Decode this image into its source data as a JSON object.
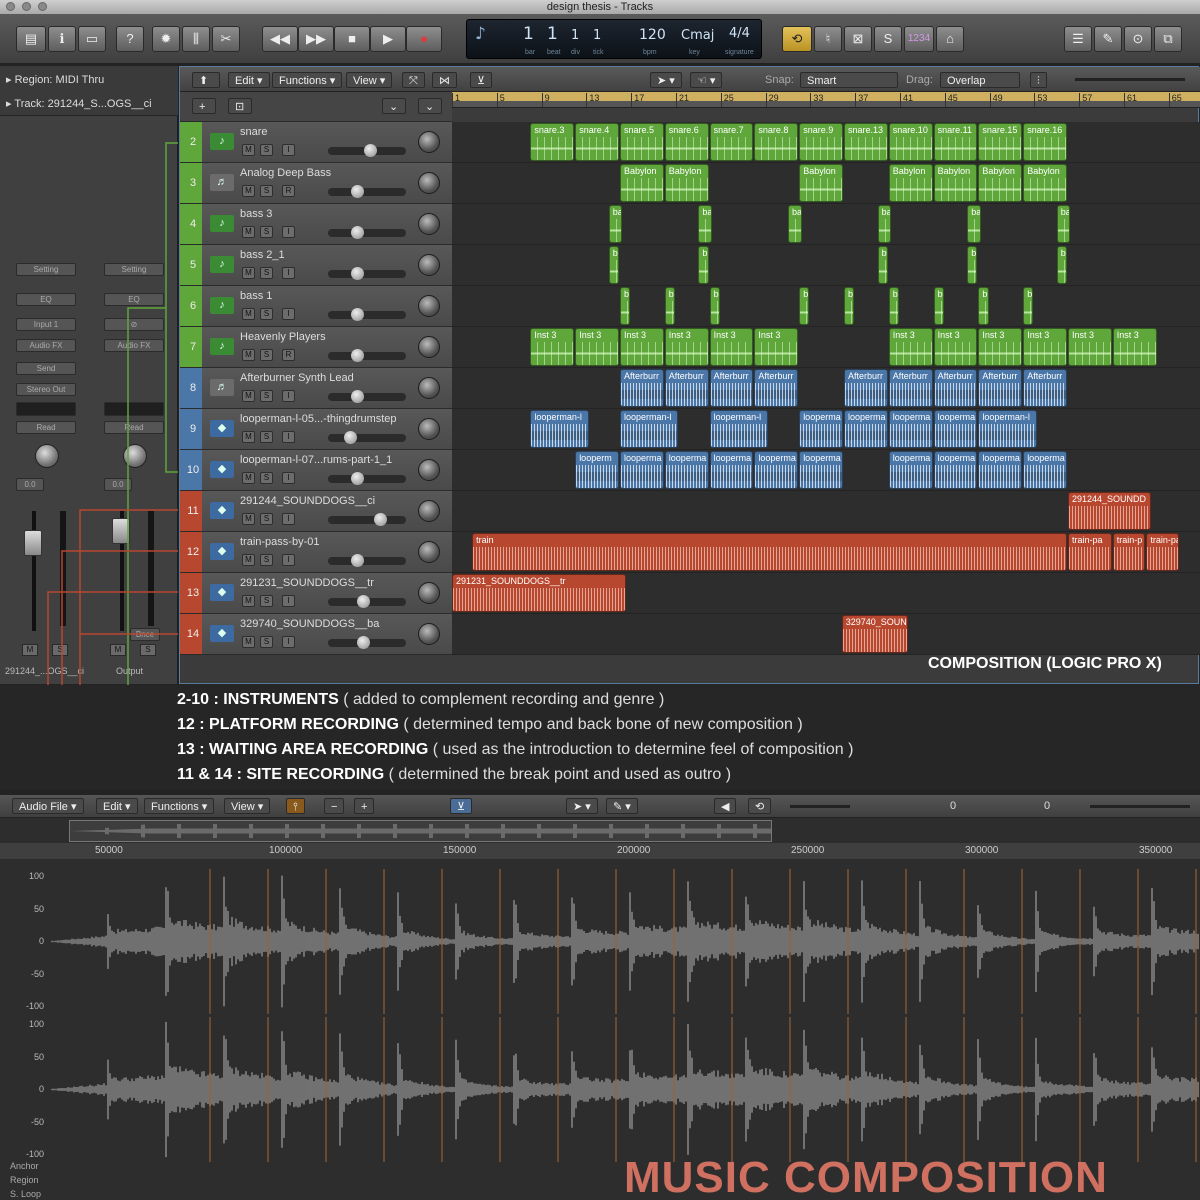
{
  "window": {
    "title": "design thesis - Tracks"
  },
  "lcd": {
    "bar": "1",
    "beat": "1",
    "div": "1",
    "tick": "1",
    "bpm": "120",
    "key": "Cmaj",
    "signature": "4/4",
    "labels": {
      "bar": "bar",
      "beat": "beat",
      "div": "div",
      "tick": "tick",
      "bpm": "bpm",
      "key": "key",
      "signature": "signature"
    }
  },
  "toolbar": {
    "count_in": "1234"
  },
  "inspector": {
    "region": "Region: MIDI Thru",
    "track": "Track: 291244_S...OGS__ci",
    "left_strip": {
      "setting": "Setting",
      "eq": "EQ",
      "input": "Input 1",
      "audio_fx": "Audio FX",
      "send": "Send",
      "output": "Stereo Out",
      "mode": "Read",
      "value": "0.0",
      "name": "291244_...OGS__ci"
    },
    "right_strip": {
      "setting": "Setting",
      "eq": "EQ",
      "audio_fx": "Audio FX",
      "mode": "Read",
      "value": "0.0",
      "bounce": "Bnce",
      "name": "Output"
    }
  },
  "local_bar": {
    "edit": "Edit",
    "functions": "Functions",
    "view": "View",
    "snap_label": "Snap:",
    "snap_value": "Smart",
    "drag_label": "Drag:",
    "drag_value": "Overlap"
  },
  "ruler": [
    "1",
    "5",
    "9",
    "13",
    "17",
    "21",
    "25",
    "29",
    "33",
    "37",
    "41",
    "45",
    "49",
    "53",
    "57",
    "61",
    "65"
  ],
  "tracks": [
    {
      "num": "2",
      "name": "snare",
      "color": "green",
      "type": "midi",
      "third": "I",
      "vol": 0.55,
      "regions": [
        {
          "l": "snare.3",
          "s": 8,
          "e": 12
        },
        {
          "l": "snare.4",
          "s": 12,
          "e": 16
        },
        {
          "l": "snare.5",
          "s": 16,
          "e": 20
        },
        {
          "l": "snare.6",
          "s": 20,
          "e": 24
        },
        {
          "l": "snare.7",
          "s": 24,
          "e": 28
        },
        {
          "l": "snare.8",
          "s": 28,
          "e": 32
        },
        {
          "l": "snare.9",
          "s": 32,
          "e": 36
        },
        {
          "l": "snare.13",
          "s": 36,
          "e": 40
        },
        {
          "l": "snare.10",
          "s": 40,
          "e": 44
        },
        {
          "l": "snare.11",
          "s": 44,
          "e": 48
        },
        {
          "l": "snare.15",
          "s": 48,
          "e": 52
        },
        {
          "l": "snare.16",
          "s": 52,
          "e": 56
        }
      ]
    },
    {
      "num": "3",
      "name": "Analog Deep Bass",
      "color": "green",
      "type": "synth",
      "third": "R",
      "vol": 0.35,
      "regions": [
        {
          "l": "Babylon",
          "s": 16,
          "e": 20
        },
        {
          "l": "Babylon",
          "s": 20,
          "e": 24
        },
        {
          "l": "Babylon",
          "s": 32,
          "e": 36
        },
        {
          "l": "Babylon",
          "s": 40,
          "e": 44
        },
        {
          "l": "Babylon",
          "s": 44,
          "e": 48
        },
        {
          "l": "Babylon",
          "s": 48,
          "e": 52
        },
        {
          "l": "Babylon",
          "s": 52,
          "e": 56
        }
      ]
    },
    {
      "num": "4",
      "name": "bass 3",
      "color": "green",
      "type": "midi",
      "third": "I",
      "vol": 0.35,
      "regions": [
        {
          "l": "ba",
          "s": 15,
          "e": 16.3
        },
        {
          "l": "ba",
          "s": 23,
          "e": 24.3
        },
        {
          "l": "ba",
          "s": 31,
          "e": 32.3
        },
        {
          "l": "ba",
          "s": 39,
          "e": 40.3
        },
        {
          "l": "ba",
          "s": 47,
          "e": 48.3
        },
        {
          "l": "ba",
          "s": 55,
          "e": 56.3
        }
      ]
    },
    {
      "num": "5",
      "name": "bass 2_1",
      "color": "green",
      "type": "midi",
      "third": "I",
      "vol": 0.35,
      "regions": [
        {
          "l": "b",
          "s": 15,
          "e": 16
        },
        {
          "l": "b",
          "s": 23,
          "e": 24
        },
        {
          "l": "b",
          "s": 39,
          "e": 40
        },
        {
          "l": "b",
          "s": 47,
          "e": 48
        },
        {
          "l": "b",
          "s": 55,
          "e": 56
        }
      ]
    },
    {
      "num": "6",
      "name": "bass 1",
      "color": "green",
      "type": "midi",
      "third": "I",
      "vol": 0.35,
      "regions": [
        {
          "l": "b",
          "s": 16,
          "e": 17
        },
        {
          "l": "b",
          "s": 20,
          "e": 21
        },
        {
          "l": "b",
          "s": 24,
          "e": 25
        },
        {
          "l": "b",
          "s": 32,
          "e": 33
        },
        {
          "l": "b",
          "s": 36,
          "e": 37
        },
        {
          "l": "b",
          "s": 40,
          "e": 41
        },
        {
          "l": "b",
          "s": 44,
          "e": 45
        },
        {
          "l": "b",
          "s": 48,
          "e": 49
        },
        {
          "l": "b",
          "s": 52,
          "e": 53
        }
      ]
    },
    {
      "num": "7",
      "name": "Heavenly Players",
      "color": "green",
      "type": "midi",
      "third": "R",
      "vol": 0.35,
      "regions": [
        {
          "l": "Inst 3",
          "s": 8,
          "e": 12
        },
        {
          "l": "Inst 3",
          "s": 12,
          "e": 16
        },
        {
          "l": "Inst 3",
          "s": 16,
          "e": 20
        },
        {
          "l": "Inst 3",
          "s": 20,
          "e": 24
        },
        {
          "l": "Inst 3",
          "s": 24,
          "e": 28
        },
        {
          "l": "Inst 3",
          "s": 28,
          "e": 32
        },
        {
          "l": "Inst 3",
          "s": 40,
          "e": 44
        },
        {
          "l": "Inst 3",
          "s": 44,
          "e": 48
        },
        {
          "l": "Inst 3",
          "s": 48,
          "e": 52
        },
        {
          "l": "Inst 3",
          "s": 52,
          "e": 56
        },
        {
          "l": "Inst 3",
          "s": 56,
          "e": 60
        },
        {
          "l": "Inst 3",
          "s": 60,
          "e": 64
        }
      ]
    },
    {
      "num": "8",
      "name": "Afterburner Synth Lead",
      "color": "blue",
      "type": "synth",
      "third": "I",
      "vol": 0.35,
      "regions": [
        {
          "l": "Afterburr",
          "s": 16,
          "e": 20
        },
        {
          "l": "Afterburr",
          "s": 20,
          "e": 24
        },
        {
          "l": "Afterburr",
          "s": 24,
          "e": 28
        },
        {
          "l": "Afterburr",
          "s": 28,
          "e": 32
        },
        {
          "l": "Afterburr",
          "s": 36,
          "e": 40
        },
        {
          "l": "Afterburr",
          "s": 40,
          "e": 44
        },
        {
          "l": "Afterburr",
          "s": 44,
          "e": 48
        },
        {
          "l": "Afterburr",
          "s": 48,
          "e": 52
        },
        {
          "l": "Afterburr",
          "s": 52,
          "e": 56
        }
      ]
    },
    {
      "num": "9",
      "name": "looperman-l-05...-thingdrumstep",
      "color": "blue",
      "type": "audio",
      "third": "I",
      "vol": 0.25,
      "regions": [
        {
          "l": "looperman-l",
          "s": 8,
          "e": 13.3
        },
        {
          "l": "looperman-l",
          "s": 16,
          "e": 21.3
        },
        {
          "l": "looperman-l",
          "s": 24,
          "e": 29.3
        },
        {
          "l": "looperma",
          "s": 32,
          "e": 36
        },
        {
          "l": "looperma",
          "s": 36,
          "e": 40
        },
        {
          "l": "looperma",
          "s": 40,
          "e": 44
        },
        {
          "l": "looperma",
          "s": 44,
          "e": 48
        },
        {
          "l": "looperman-l",
          "s": 48,
          "e": 53.3
        }
      ]
    },
    {
      "num": "10",
      "name": "looperman-l-07...rums-part-1_1",
      "color": "blue",
      "type": "audio",
      "third": "I",
      "vol": 0.35,
      "regions": [
        {
          "l": "looperm",
          "s": 12,
          "e": 16
        },
        {
          "l": "looperma",
          "s": 16,
          "e": 20
        },
        {
          "l": "looperma",
          "s": 20,
          "e": 24
        },
        {
          "l": "looperma",
          "s": 24,
          "e": 28
        },
        {
          "l": "looperma",
          "s": 28,
          "e": 32
        },
        {
          "l": "looperma",
          "s": 32,
          "e": 36
        },
        {
          "l": "looperma",
          "s": 40,
          "e": 44
        },
        {
          "l": "looperma",
          "s": 44,
          "e": 48
        },
        {
          "l": "looperma",
          "s": 48,
          "e": 52
        },
        {
          "l": "looperma",
          "s": 52,
          "e": 56
        }
      ]
    },
    {
      "num": "11",
      "name": "291244_SOUNDDOGS__ci",
      "color": "red",
      "type": "audio",
      "third": "I",
      "vol": 0.7,
      "regions": [
        {
          "l": "291244_SOUNDD",
          "s": 56,
          "e": 63.5
        }
      ]
    },
    {
      "num": "12",
      "name": "train-pass-by-01",
      "color": "red",
      "type": "audio",
      "third": "I",
      "vol": 0.35,
      "regions": [
        {
          "l": "train",
          "s": 2.8,
          "e": 56
        },
        {
          "l": "train-pa",
          "s": 56,
          "e": 60
        },
        {
          "l": "train-p",
          "s": 60,
          "e": 63
        },
        {
          "l": "train-pa",
          "s": 63,
          "e": 66
        }
      ]
    },
    {
      "num": "13",
      "name": "291231_SOUNDDOGS__tr",
      "color": "red",
      "type": "audio",
      "third": "I",
      "vol": 0.45,
      "regions": [
        {
          "l": "291231_SOUNDDOGS__tr",
          "s": 1,
          "e": 16.6
        }
      ]
    },
    {
      "num": "14",
      "name": "329740_SOUNDDOGS__ba",
      "color": "red",
      "type": "audio",
      "third": "I",
      "vol": 0.45,
      "regions": [
        {
          "l": "329740_SOUN",
          "s": 35.8,
          "e": 41.8
        }
      ]
    }
  ],
  "composition_label": "COMPOSITION (LOGIC PRO X)",
  "annotations": [
    {
      "key": "2-10 : INSTRUMENTS",
      "desc": " ( added to complement recording and genre )"
    },
    {
      "key": "12 : PLATFORM RECORDING",
      "desc": " ( determined tempo and back bone of new composition )"
    },
    {
      "key": "13 : WAITING AREA RECORDING",
      "desc": " ( used as the introduction to determine feel of composition )"
    },
    {
      "key": "11 & 14 : SITE RECORDING",
      "desc": " ( determined the break point and used as outro )"
    }
  ],
  "editor": {
    "menus": {
      "audio_file": "Audio File",
      "edit": "Edit",
      "functions": "Functions",
      "view": "View"
    },
    "readout_a": "0",
    "readout_b": "0",
    "ruler": [
      "50000",
      "100000",
      "150000",
      "200000",
      "250000",
      "300000",
      "350000"
    ],
    "y_ticks": [
      "100",
      "50",
      "0",
      "-50",
      "-100"
    ],
    "side_labels": [
      "Anchor",
      "Region",
      "S. Loop"
    ]
  },
  "page_title": "MUSIC COMPOSITION",
  "colors": {
    "green": "#5fa63b",
    "blue": "#4a76a8",
    "red": "#b8472f",
    "accent": "#d07060"
  }
}
